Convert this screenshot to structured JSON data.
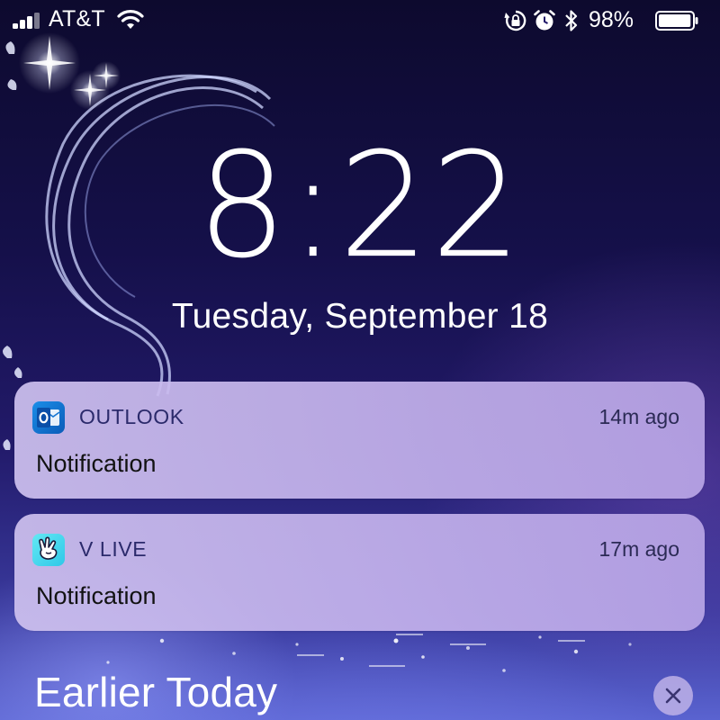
{
  "status_bar": {
    "carrier": "AT&T",
    "battery_percent": "98%",
    "battery_level": 0.98,
    "icons": [
      "signal-icon",
      "wifi-icon",
      "orientation-lock-icon",
      "alarm-icon",
      "bluetooth-icon",
      "battery-icon"
    ]
  },
  "lock_screen": {
    "time": "8:22",
    "date": "Tuesday, September 18"
  },
  "notifications": [
    {
      "app": "OUTLOOK",
      "time": "14m ago",
      "body": "Notification",
      "icon": "outlook-icon",
      "accent": "#1a7fd8"
    },
    {
      "app": "V LIVE",
      "time": "17m ago",
      "body": "Notification",
      "icon": "vlive-icon",
      "accent": "#3fd3ec"
    }
  ],
  "earlier_section": {
    "title": "Earlier Today",
    "clear_icon": "close-icon"
  }
}
